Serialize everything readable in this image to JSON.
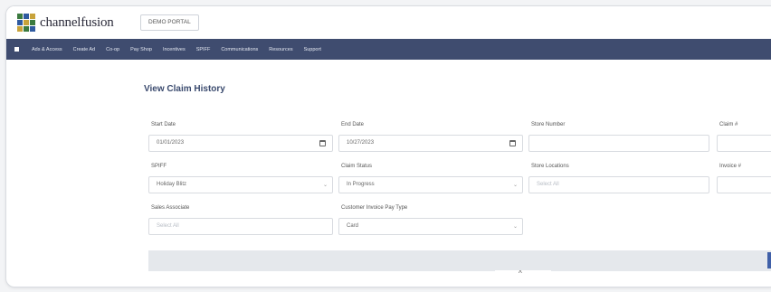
{
  "header": {
    "logo_text": "channelfusion",
    "logo_colors": [
      "#3b7a3f",
      "#2f5aa0",
      "#c8a33b",
      "#2f5aa0",
      "#c8a33b",
      "#3b7a3f",
      "#c8a33b",
      "#3b7a3f",
      "#2f5aa0"
    ],
    "portal_label": "DEMO PORTAL"
  },
  "nav": {
    "home_icon": "home-icon",
    "items": [
      {
        "label": "Ads & Access"
      },
      {
        "label": "Create Ad"
      },
      {
        "label": "Co-op"
      },
      {
        "label": "Pay Shop"
      },
      {
        "label": "Incentives"
      },
      {
        "label": "SPIFF"
      },
      {
        "label": "Communications"
      },
      {
        "label": "Resources"
      },
      {
        "label": "Support"
      }
    ]
  },
  "page": {
    "title": "View Claim History"
  },
  "form": {
    "start_date": {
      "label": "Start Date",
      "value": "01/01/2023"
    },
    "end_date": {
      "label": "End Date",
      "value": "10/27/2023"
    },
    "store_number": {
      "label": "Store Number",
      "value": ""
    },
    "claim_number": {
      "label": "Claim #",
      "value": ""
    },
    "spiff": {
      "label": "SPIFF",
      "value": "Holiday Blitz"
    },
    "claim_status": {
      "label": "Claim Status",
      "value": "In Progress"
    },
    "store_locations": {
      "label": "Store Locations",
      "placeholder": "Select All"
    },
    "invoice_number": {
      "label": "Invoice #",
      "value": ""
    },
    "sales_associate": {
      "label": "Sales Associate",
      "placeholder": "Select All"
    },
    "pay_type": {
      "label": "Customer Invoice Pay Type",
      "value": "Card"
    }
  },
  "colors": {
    "nav_bg": "#3f4c6f",
    "title": "#3a4a6e",
    "action_button": "#4060a8"
  }
}
